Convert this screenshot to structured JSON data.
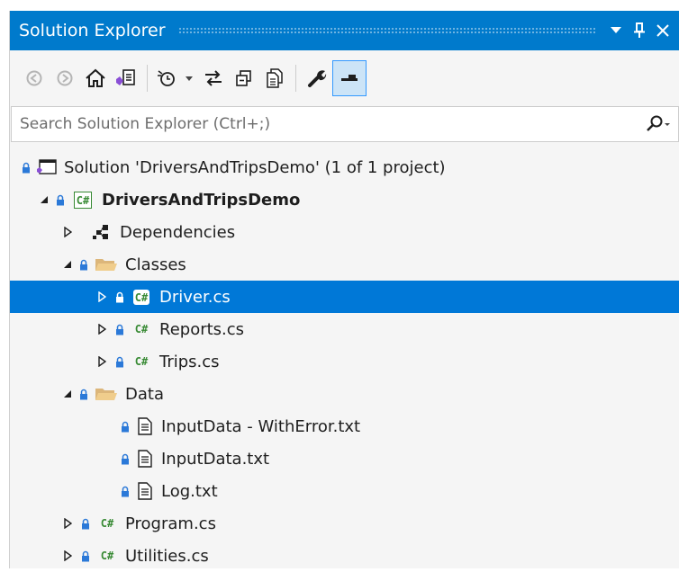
{
  "window": {
    "title": "Solution Explorer",
    "dropdown_glyph": "▼",
    "pin_glyph": "†",
    "close_glyph": "✕"
  },
  "colors": {
    "accent": "#007acc",
    "selection": "#0078d7",
    "csharp_green": "#388a34",
    "folder_yellow": "#dcb67a",
    "lock_blue": "#2b79d8"
  },
  "toolbar": {
    "buttons": [
      {
        "name": "back-button",
        "icon": "circle-back-icon"
      },
      {
        "name": "forward-button",
        "icon": "circle-forward-icon"
      },
      {
        "name": "home-button",
        "icon": "home-icon"
      },
      {
        "name": "switch-views-button",
        "icon": "vs-solution-switch-icon"
      },
      {
        "name": "pending-changes-filter-button",
        "icon": "clock-filter-icon"
      },
      {
        "name": "sync-with-active-document-button",
        "icon": "sync-arrows-icon"
      },
      {
        "name": "collapse-all-button",
        "icon": "collapse-all-icon"
      },
      {
        "name": "show-all-files-button",
        "icon": "show-all-files-icon"
      },
      {
        "name": "properties-button",
        "icon": "wrench-icon"
      },
      {
        "name": "preview-selected-items-button",
        "icon": "preview-icon",
        "active": true
      }
    ]
  },
  "search": {
    "placeholder": "Search Solution Explorer (Ctrl+;)",
    "value": ""
  },
  "tree": {
    "solution": "Solution 'DriversAndTripsDemo' (1 of 1 project)",
    "project": "DriversAndTripsDemo",
    "project_icon_text": "C#",
    "csharp_icon_text": "C#",
    "dependencies": "Dependencies",
    "classes_folder": "Classes",
    "classes_files": [
      "Driver.cs",
      "Reports.cs",
      "Trips.cs"
    ],
    "selected_file": "Driver.cs",
    "data_folder": "Data",
    "data_files": [
      "InputData - WithError.txt",
      "InputData.txt",
      "Log.txt"
    ],
    "root_files": [
      "Program.cs",
      "Utilities.cs"
    ]
  }
}
